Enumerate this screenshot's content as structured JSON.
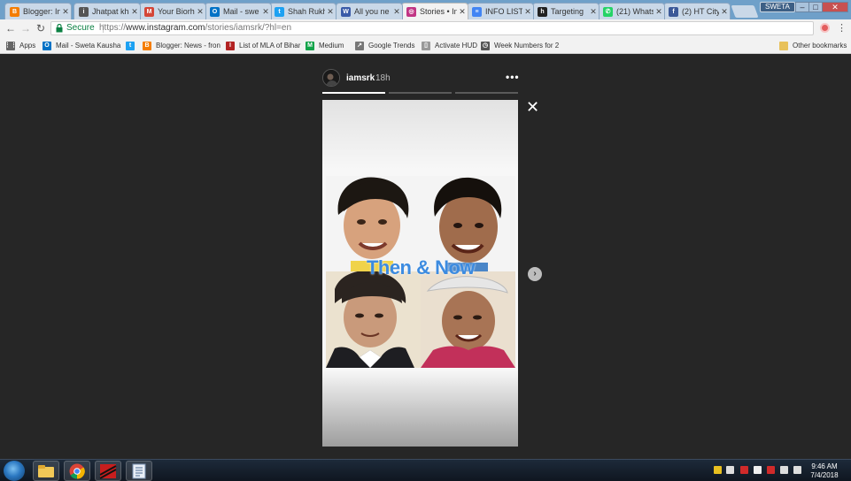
{
  "browser": {
    "tabs": [
      {
        "label": "Blogger: In",
        "icon": "blogger-icon",
        "color": "#f57d00",
        "glyph": "B"
      },
      {
        "label": "Jhatpat kha",
        "icon": "person-icon",
        "color": "#555555",
        "glyph": "i"
      },
      {
        "label": "Your Biorh",
        "icon": "gmail-icon",
        "color": "#d44638",
        "glyph": "M"
      },
      {
        "label": "Mail - swe",
        "icon": "outlook-icon",
        "color": "#0072c6",
        "glyph": "O"
      },
      {
        "label": "Shah Rukh",
        "icon": "twitter-icon",
        "color": "#1da1f2",
        "glyph": "t"
      },
      {
        "label": "All you ne",
        "icon": "news-icon",
        "color": "#3a5aa8",
        "glyph": "W"
      },
      {
        "label": "Stories • In",
        "icon": "instagram-icon",
        "color": "#c13584",
        "glyph": "◎",
        "active": true
      },
      {
        "label": "INFO LIST",
        "icon": "docs-icon",
        "color": "#4285f4",
        "glyph": "≡"
      },
      {
        "label": "Targeting",
        "icon": "hootsuite-icon",
        "color": "#222222",
        "glyph": "h"
      },
      {
        "label": "(21) Whats",
        "icon": "whatsapp-icon",
        "color": "#25d366",
        "glyph": "✆"
      },
      {
        "label": "(2) HT City",
        "icon": "facebook-icon",
        "color": "#3b5998",
        "glyph": "f"
      }
    ],
    "profile_name": "SWETA",
    "window_controls": {
      "minimize": "–",
      "maximize": "□",
      "close": "✕"
    },
    "omnibox": {
      "security_label": "Secure",
      "url_prefix": "https://",
      "url_host": "www.instagram.com",
      "url_path": "/stories/iamsrk/?hl=en"
    },
    "bookmarks": [
      {
        "label": "Apps",
        "icon": "apps-grid-icon",
        "color": "#666666",
        "glyph": "⋮⋮"
      },
      {
        "label": "Mail - Sweta Kausha",
        "icon": "outlook-icon",
        "color": "#0072c6",
        "glyph": "O"
      },
      {
        "label": "",
        "icon": "twitter-icon",
        "color": "#1da1f2",
        "glyph": "t"
      },
      {
        "label": "Blogger: News - fron",
        "icon": "blogger-icon",
        "color": "#f57d00",
        "glyph": "B"
      },
      {
        "label": "List of MLA of Bihar",
        "icon": "wikipedia-icon",
        "color": "#b22222",
        "glyph": "I"
      },
      {
        "label": "Medium",
        "icon": "medium-icon",
        "color": "#12a44a",
        "glyph": "M"
      },
      {
        "label": "Google Trends",
        "icon": "trends-icon",
        "color": "#777777",
        "glyph": "↗"
      },
      {
        "label": "Activate HUD",
        "icon": "page-icon",
        "color": "#999999",
        "glyph": "▯"
      },
      {
        "label": "Week Numbers for 2",
        "icon": "clock-icon",
        "color": "#555555",
        "glyph": "◷"
      }
    ],
    "other_bookmarks": "Other bookmarks"
  },
  "story": {
    "username": "iamsrk",
    "age": "18h",
    "more": "•••",
    "caption": "Then & Now",
    "close": "✕",
    "next": "›",
    "segments": [
      {
        "state": "played",
        "fill": 1.0
      },
      {
        "state": "pending",
        "fill": 0.0
      },
      {
        "state": "pending",
        "fill": 0.0
      }
    ]
  },
  "taskbar": {
    "time": "9:46 AM",
    "date": "7/4/2018",
    "apps": [
      "explorer-icon",
      "chrome-icon",
      "app-red-icon",
      "app-document-icon"
    ]
  },
  "colors": {
    "page_bg": "#262626",
    "caption_blue": "#3c8be0",
    "tab_strip": "#6fa0c9"
  }
}
